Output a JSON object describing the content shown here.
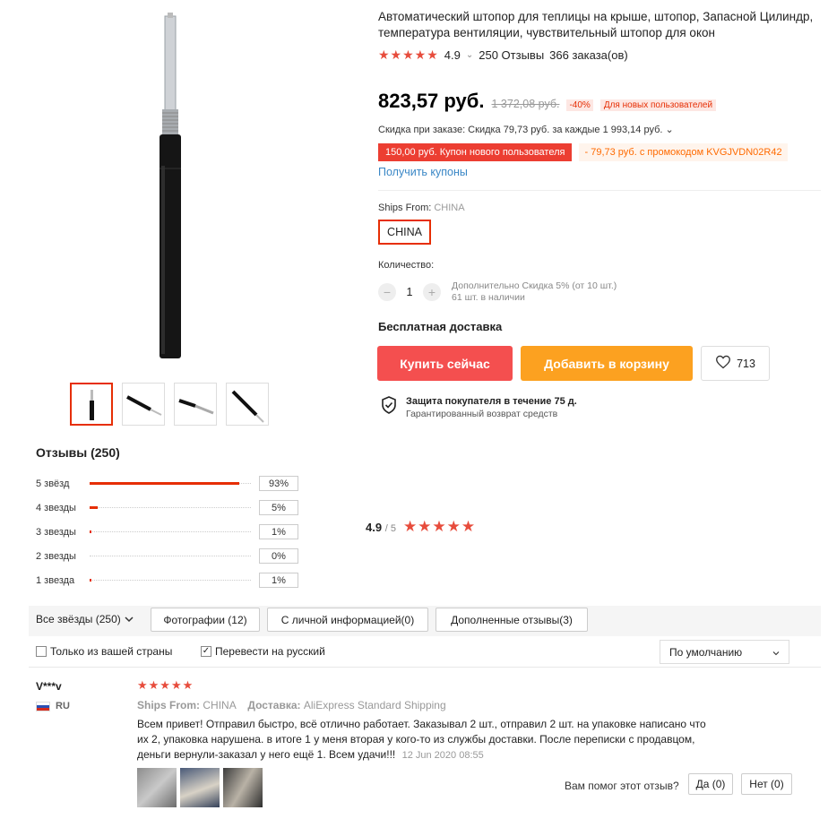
{
  "product": {
    "title": "Автоматический штопор для теплицы на крыше, штопор, Запасной Цилиндр, температура вентиляции, чувствительный штопор для окон",
    "rating": "4.9",
    "rating_caret": "⌄",
    "reviews_count": "250 Отзывы",
    "orders": "366 заказа(ов)",
    "price": "823,57 руб.",
    "old_price": "1 372,08 руб.",
    "discount_pct": "-40%",
    "new_user_badge": "Для новых пользователей",
    "store_discount": "Скидка при заказе: Скидка 79,73 руб. за каждые 1 993,14 руб. ⌄",
    "coupon_new_user": "150,00 руб. Купон нового пользователя",
    "coupon_promo": "- 79,73 руб. с промокодом KVGJVDN02R42",
    "get_coupons": "Получить купоны",
    "ships_from_label": "Ships From:",
    "ships_from_value": "CHINA",
    "ships_option": "CHINA",
    "qty_label": "Количество:",
    "qty_value": "1",
    "qty_note_1": "Дополнительно Скидка 5% (от 10 шт.)",
    "qty_note_2": "61 шт. в наличии",
    "free_shipping": "Бесплатная доставка",
    "buy_now": "Купить сейчас",
    "add_to_cart": "Добавить в корзину",
    "wishlist_count": "713",
    "protection_title": "Защита покупателя в течение 75 д.",
    "protection_sub": "Гарантированный возврат средств"
  },
  "reviews_summary": {
    "heading": "Отзывы (250)",
    "bars": [
      {
        "label": "5 звёзд",
        "pct": "93%",
        "fill": 0.93
      },
      {
        "label": "4 звезды",
        "pct": "5%",
        "fill": 0.05
      },
      {
        "label": "3 звезды",
        "pct": "1%",
        "fill": 0.01
      },
      {
        "label": "2 звезды",
        "pct": "0%",
        "fill": 0.0
      },
      {
        "label": "1 звезда",
        "pct": "1%",
        "fill": 0.01
      }
    ],
    "avg": "4.9",
    "avg_max": "/ 5"
  },
  "filters": {
    "all_stars": "Все звёзды (250)",
    "photos": "Фотографии (12)",
    "with_personal": "С личной информацией(0)",
    "additional": "Дополненные отзывы(3)",
    "only_country": "Только из вашей страны",
    "translate": "Перевести на русский",
    "sort": "По умолчанию"
  },
  "review": {
    "user": "V***v",
    "country": "RU",
    "stars": "★★★★★",
    "ships_label": "Ships From:",
    "ships_value": "CHINA",
    "delivery_label": "Доставка:",
    "delivery_value": "AliExpress Standard Shipping",
    "text": "Всем привет! Отправил быстро, всё отлично работает. Заказывал 2 шт., отправил 2 шт. на упаковке написано что их 2, упаковка нарушена. в итоге 1 у меня вторая у кого-то из службы доставки. После переписки с продавцом, деньги вернули-заказал у него ещё 1. Всем удачи!!!",
    "date": "12 Jun 2020 08:55",
    "helpful_q": "Вам помог этот отзыв?",
    "yes": "Да (0)",
    "no": "Нет (0)"
  },
  "colors": {
    "accent_red": "#e62e04",
    "buy": "#f44f4f",
    "cart": "#fca120",
    "star": "#e74c3c",
    "link": "#3a87c6"
  }
}
